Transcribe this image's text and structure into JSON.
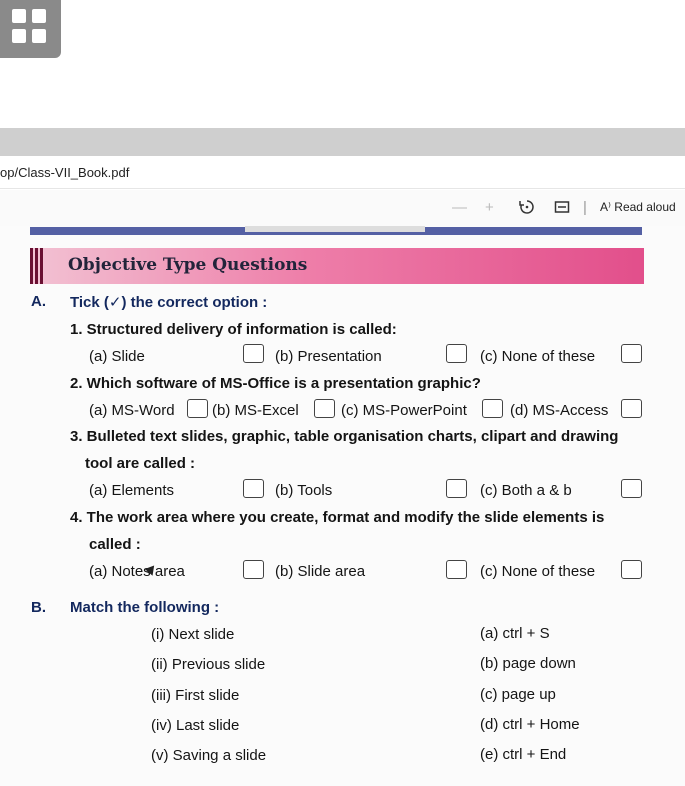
{
  "browser": {
    "address": "op/Class-VII_Book.pdf",
    "toolbar": {
      "zoom_out": "—",
      "zoom_in": "+",
      "read_aloud": "A⁾ Read aloud"
    }
  },
  "doc": {
    "section_title": "Objective Type Questions",
    "A": {
      "letter": "A.",
      "heading": "Tick (✓) the correct option :",
      "questions": [
        {
          "text": "1. Structured delivery of information is called:",
          "options": [
            "(a) Slide",
            "(b) Presentation",
            "(c) None of these"
          ]
        },
        {
          "text": "2. Which software of MS-Office is a presentation graphic?",
          "options": [
            "(a) MS-Word",
            "(b) MS-Excel",
            "(c) MS-PowerPoint",
            "(d) MS-Access"
          ]
        },
        {
          "text": "3. Bulleted text slides, graphic, table organisation charts, clipart and drawing",
          "text_cont": "tool are called :",
          "options": [
            "(a) Elements",
            "(b) Tools",
            "(c) Both a & b"
          ]
        },
        {
          "text": "4. The work area where you create, format and modify the slide elements is",
          "text_cont": "called :",
          "options": [
            "(a) Notes area",
            "(b) Slide area",
            "(c) None of these"
          ]
        }
      ]
    },
    "B": {
      "letter": "B.",
      "heading": "Match the following :",
      "left": [
        "(i) Next slide",
        "(ii) Previous slide",
        "(iii) First slide",
        "(iv) Last slide",
        "(v) Saving a slide"
      ],
      "right": [
        "(a) ctrl + S",
        "(b) page down",
        "(c) page up",
        "(d) ctrl + Home",
        "(e) ctrl + End"
      ]
    }
  }
}
